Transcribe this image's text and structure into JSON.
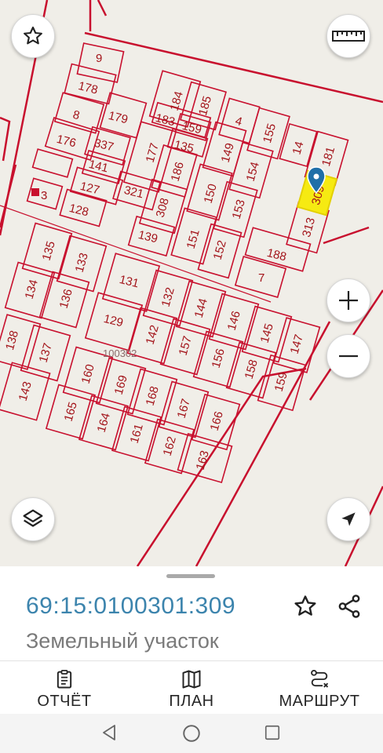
{
  "map": {
    "block_label": "100302",
    "parcels": [
      "9",
      "178",
      "184",
      "185",
      "8",
      "179",
      "183",
      "159",
      "4",
      "155",
      "176",
      "337",
      "135",
      "177",
      "149",
      "14",
      "181",
      "141",
      "186",
      "154",
      "127",
      "321",
      "150",
      "309",
      "3",
      "308",
      "153",
      "128",
      "313",
      "139",
      "151",
      "188",
      "135",
      "133",
      "152",
      "7",
      "131",
      "134",
      "136",
      "132",
      "144",
      "146",
      "129",
      "145",
      "138",
      "142",
      "147",
      "137",
      "157",
      "156",
      "158",
      "160",
      "169",
      "159",
      "143",
      "168",
      "167",
      "165",
      "166",
      "164",
      "161",
      "162",
      "163"
    ],
    "selected_parcel": "309",
    "colors": {
      "boundary": "#c8102e",
      "selected_fill": "#f6ea12",
      "marker": "#1f6fa8",
      "map_bg": "#f0eee8"
    },
    "controls": {
      "favorite_icon": "star-icon",
      "ruler_icon": "ruler-icon",
      "zoom_in_icon": "plus-icon",
      "zoom_out_icon": "minus-icon",
      "layers_icon": "layers-icon",
      "locate_icon": "navigation-arrow-icon"
    }
  },
  "sheet": {
    "cadastral_number": "69:15:0100301:309",
    "object_type": "Земельный участок",
    "favorite_icon": "star-outline-icon",
    "share_icon": "share-icon"
  },
  "bottom_nav": {
    "items": [
      {
        "label": "ОТЧЁТ",
        "icon": "report-icon"
      },
      {
        "label": "ПЛАН",
        "icon": "map-icon"
      },
      {
        "label": "МАРШРУТ",
        "icon": "route-icon"
      }
    ]
  },
  "system_nav": {
    "back_icon": "back-triangle-icon",
    "home_icon": "home-circle-icon",
    "recents_icon": "recents-square-icon"
  }
}
